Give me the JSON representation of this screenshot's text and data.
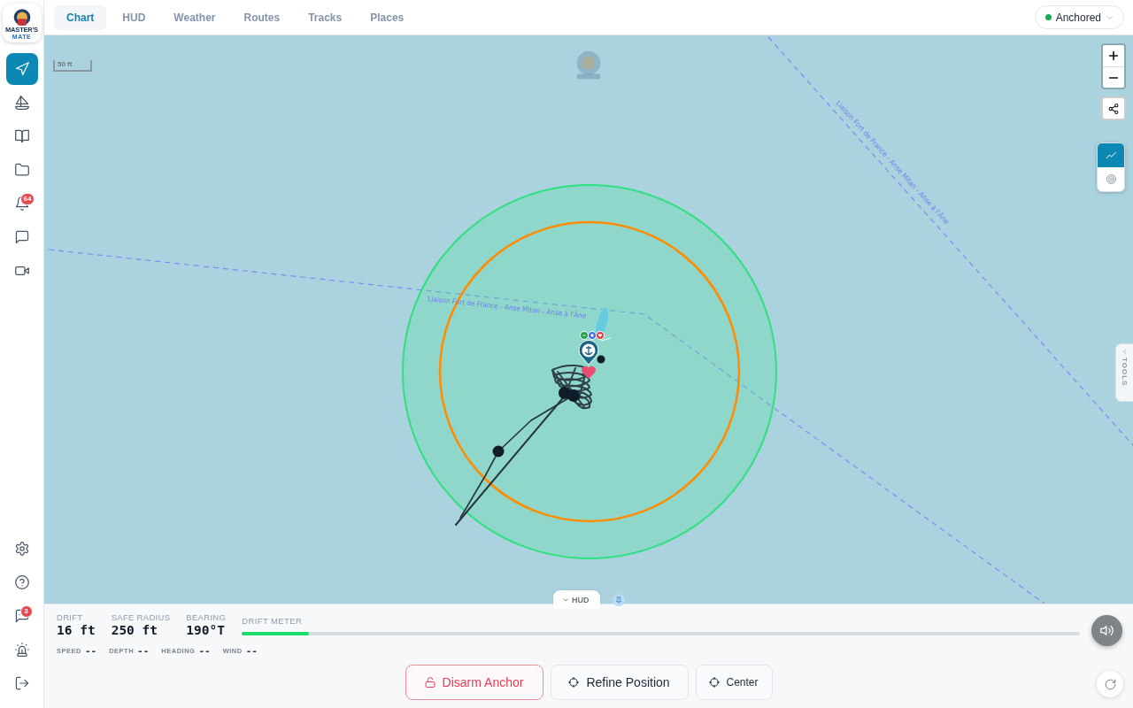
{
  "sidebar": {
    "logo": {
      "title": "MASTER'S",
      "subtitle": "MATE"
    },
    "nav_items": [
      {
        "selected": true
      },
      {
        "selected": false
      },
      {
        "selected": false
      },
      {
        "selected": false
      },
      {
        "selected": false,
        "badge": "64"
      },
      {
        "selected": false
      },
      {
        "selected": false
      }
    ],
    "bottom_items": [
      {
        "selected": false
      },
      {
        "selected": false
      },
      {
        "selected": false,
        "badge": "3"
      },
      {
        "selected": false
      },
      {
        "selected": false
      }
    ]
  },
  "tabs": [
    {
      "label": "Chart",
      "selected": true
    },
    {
      "label": "HUD",
      "selected": false
    },
    {
      "label": "Weather",
      "selected": false
    },
    {
      "label": "Routes",
      "selected": false
    },
    {
      "label": "Tracks",
      "selected": false
    },
    {
      "label": "Places",
      "selected": false
    }
  ],
  "status": {
    "label": "Anchored",
    "active": true
  },
  "map": {
    "scale": "50 ft",
    "route_labels": [
      "Liaison Fort de France - Anse Mitan - Anse à l'Âne",
      "Liaison Fort de France - Anse Mitan - Anse à l'Âne"
    ],
    "layers": [
      {
        "selected": true
      },
      {
        "selected": false
      }
    ],
    "tools_label": "TOOLS"
  },
  "hud": {
    "toggle_label": "HUD",
    "pinned": true,
    "stats": [
      {
        "label": "DRIFT",
        "value": "16 ft"
      },
      {
        "label": "SAFE RADIUS",
        "value": "250 ft"
      },
      {
        "label": "BEARING",
        "value": "190°T"
      }
    ],
    "meter": {
      "label": "DRIFT METER",
      "level": 0.08
    },
    "readings": [
      {
        "label": "SPEED",
        "value": "--"
      },
      {
        "label": "DEPTH",
        "value": "--"
      },
      {
        "label": "HEADING",
        "value": "--"
      },
      {
        "label": "WIND",
        "value": "--"
      }
    ],
    "actions": [
      {
        "label": "Disarm Anchor",
        "kind": "danger"
      },
      {
        "label": "Refine Position",
        "kind": "default"
      },
      {
        "label": "Center",
        "kind": "compact"
      }
    ]
  }
}
